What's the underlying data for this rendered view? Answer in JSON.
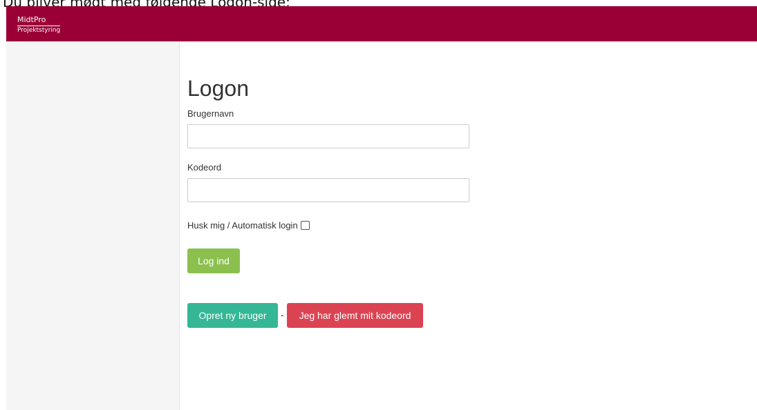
{
  "caption": "Du bliver mødt med følgende Logon-side:",
  "brand": {
    "name": "MidtPro",
    "subtitle": "Projektstyring"
  },
  "colors": {
    "header": "#9a0036",
    "login_button": "#8bc04f",
    "create_button": "#35b795",
    "forgot_button": "#dc4352"
  },
  "login": {
    "title": "Logon",
    "username_label": "Brugernavn",
    "username_value": "",
    "password_label": "Kodeord",
    "password_value": "",
    "remember_label": "Husk mig / Automatisk login",
    "remember_checked": false,
    "submit_label": "Log ind"
  },
  "actions": {
    "create_label": "Opret ny bruger",
    "separator": "-",
    "forgot_label": "Jeg har glemt mit kodeord"
  }
}
